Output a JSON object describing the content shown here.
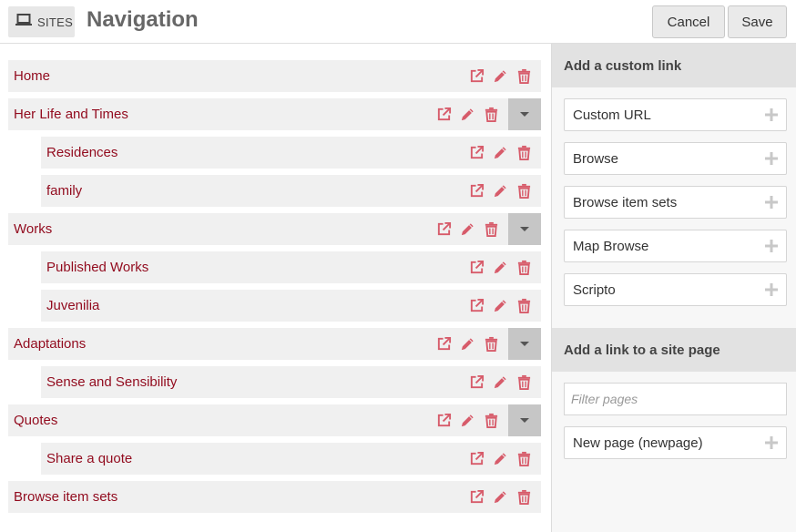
{
  "header": {
    "sites_label": "SITES",
    "title": "Navigation",
    "cancel_label": "Cancel",
    "save_label": "Save"
  },
  "colors": {
    "link": "#920b1e",
    "action_icon": "#d75b6a"
  },
  "nav": {
    "items": [
      {
        "label": "Home",
        "depth": 0,
        "has_children": false
      },
      {
        "label": "Her Life and Times",
        "depth": 0,
        "has_children": true
      },
      {
        "label": "Residences",
        "depth": 1,
        "has_children": false
      },
      {
        "label": "family",
        "depth": 1,
        "has_children": false
      },
      {
        "label": "Works",
        "depth": 0,
        "has_children": true
      },
      {
        "label": "Published Works",
        "depth": 1,
        "has_children": false
      },
      {
        "label": "Juvenilia",
        "depth": 1,
        "has_children": false
      },
      {
        "label": "Adaptations",
        "depth": 0,
        "has_children": true
      },
      {
        "label": "Sense and Sensibility",
        "depth": 1,
        "has_children": false
      },
      {
        "label": "Quotes",
        "depth": 0,
        "has_children": true
      },
      {
        "label": "Share a quote",
        "depth": 1,
        "has_children": false
      },
      {
        "label": "Browse item sets",
        "depth": 0,
        "has_children": false
      }
    ],
    "action_icons": [
      "external-link-icon",
      "pencil-icon",
      "trash-icon"
    ]
  },
  "sidebar": {
    "custom_link": {
      "title": "Add a custom link",
      "options": [
        "Custom URL",
        "Browse",
        "Browse item sets",
        "Map Browse",
        "Scripto"
      ]
    },
    "site_page": {
      "title": "Add a link to a site page",
      "filter_placeholder": "Filter pages",
      "options": [
        "New page (newpage)"
      ]
    }
  }
}
